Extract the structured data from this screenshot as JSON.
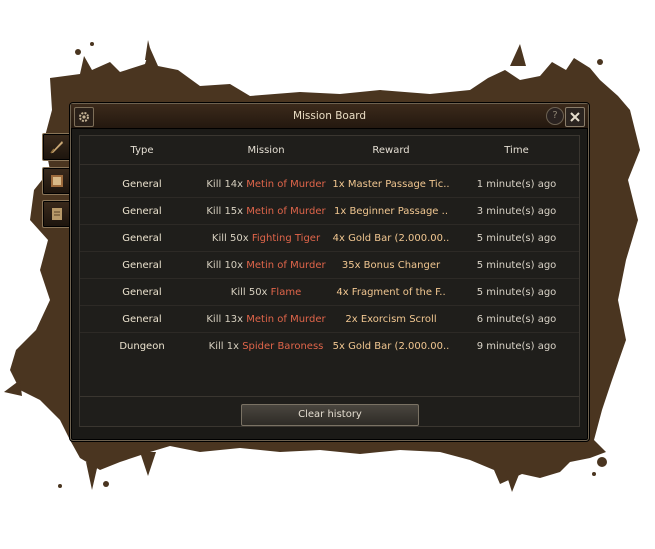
{
  "window": {
    "title": "Mission Board",
    "help_label": "?"
  },
  "table": {
    "headers": [
      "Type",
      "Mission",
      "Reward",
      "Time"
    ],
    "rows": [
      {
        "type": "General",
        "mission_prefix": "Kill 14x",
        "mission_target": "Metin of Murder",
        "reward": "1x Master Passage Tic..",
        "time": "1 minute(s) ago"
      },
      {
        "type": "General",
        "mission_prefix": "Kill 15x",
        "mission_target": "Metin of Murder",
        "reward": "1x Beginner Passage ..",
        "time": "3 minute(s) ago"
      },
      {
        "type": "General",
        "mission_prefix": "Kill 50x",
        "mission_target": "Fighting Tiger",
        "reward": "4x Gold Bar (2.000.00..",
        "time": "5 minute(s) ago"
      },
      {
        "type": "General",
        "mission_prefix": "Kill 10x",
        "mission_target": "Metin of Murder",
        "reward": "35x Bonus Changer",
        "time": "5 minute(s) ago"
      },
      {
        "type": "General",
        "mission_prefix": "Kill 50x",
        "mission_target": "Flame",
        "reward": "4x Fragment of the F..",
        "time": "5 minute(s) ago"
      },
      {
        "type": "General",
        "mission_prefix": "Kill 13x",
        "mission_target": "Metin of Murder",
        "reward": "2x Exorcism Scroll",
        "time": "6 minute(s) ago"
      },
      {
        "type": "Dungeon",
        "mission_prefix": "Kill 1x",
        "mission_target": "Spider Baroness",
        "reward": "5x Gold Bar (2.000.00..",
        "time": "9 minute(s) ago"
      }
    ]
  },
  "footer": {
    "clear_label": "Clear history"
  },
  "side_tabs": [
    "quill-icon",
    "book-icon",
    "scroll-icon"
  ],
  "colors": {
    "mission_target": "#e0654a",
    "reward": "#f1c791",
    "splatter": "#4a3520"
  }
}
